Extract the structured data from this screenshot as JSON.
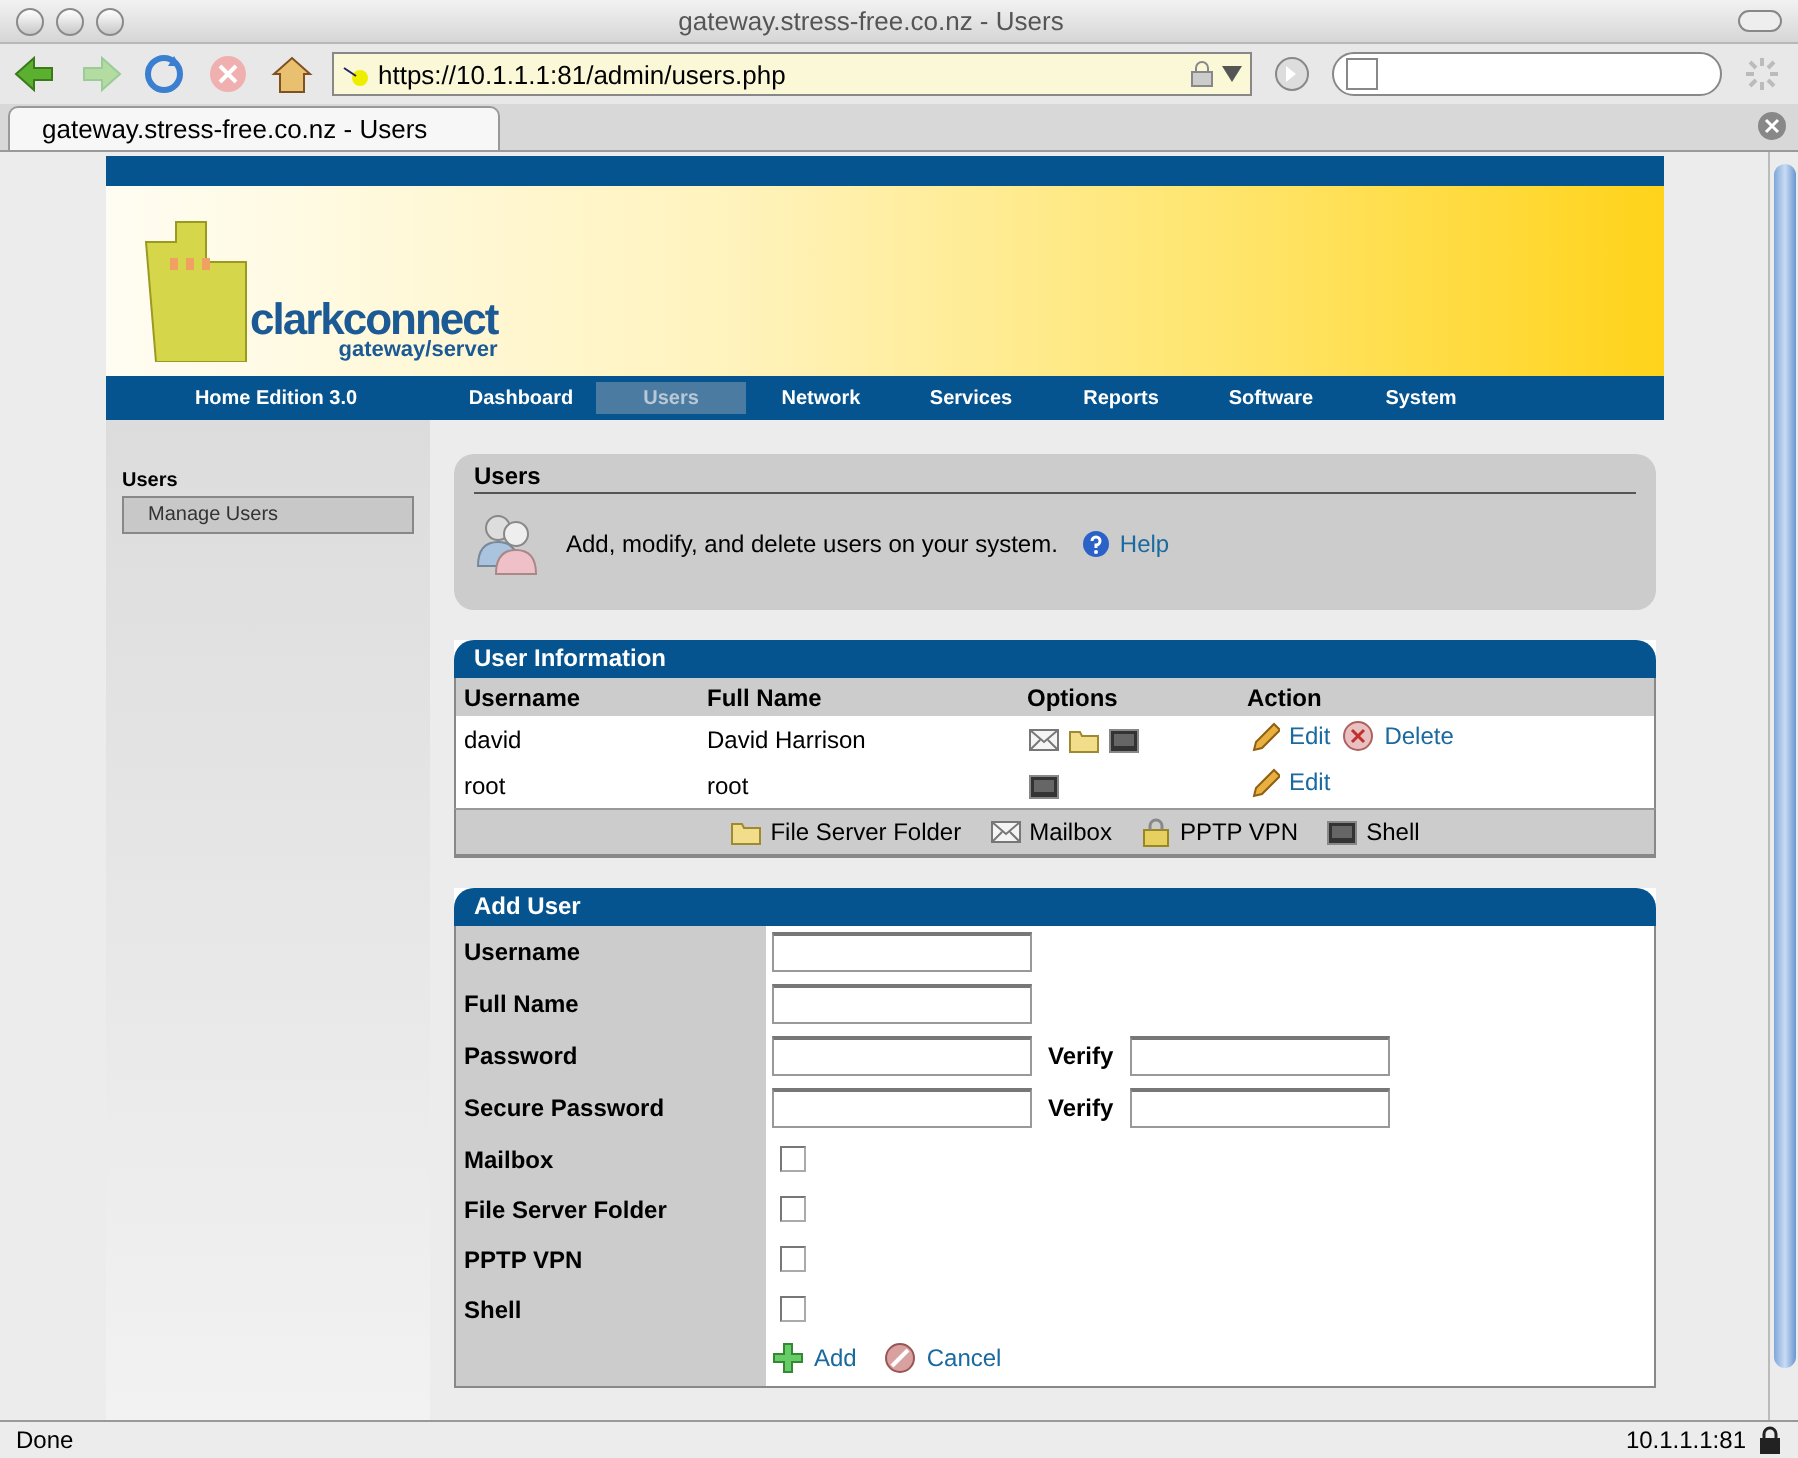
{
  "window": {
    "title": "gateway.stress-free.co.nz - Users"
  },
  "toolbar": {
    "url": "https://10.1.1.1:81/admin/users.php"
  },
  "tabs": [
    {
      "label": "gateway.stress-free.co.nz - Users",
      "selected": true
    }
  ],
  "header": {
    "logo": "clarkconnect",
    "logo_sub": "gateway/server",
    "edition": "Home Edition 3.0"
  },
  "nav": [
    {
      "label": "Dashboard",
      "selected": false
    },
    {
      "label": "Users",
      "selected": true
    },
    {
      "label": "Network",
      "selected": false
    },
    {
      "label": "Services",
      "selected": false
    },
    {
      "label": "Reports",
      "selected": false
    },
    {
      "label": "Software",
      "selected": false
    },
    {
      "label": "System",
      "selected": false
    }
  ],
  "sidebar": {
    "heading": "Users",
    "items": [
      {
        "label": "Manage Users",
        "selected": true
      }
    ]
  },
  "intro": {
    "title": "Users",
    "text": "Add, modify, and delete users on your system.",
    "help": "Help"
  },
  "user_info": {
    "title": "User Information",
    "columns": [
      "Username",
      "Full Name",
      "Options",
      "Action"
    ],
    "rows": [
      {
        "username": "david",
        "full_name": "David Harrison",
        "options": [
          {
            "kind": "mailbox"
          },
          {
            "kind": "folder"
          },
          {
            "kind": "shell"
          }
        ],
        "actions": [
          {
            "kind": "edit",
            "label": "Edit"
          },
          {
            "kind": "delete",
            "label": "Delete"
          }
        ]
      },
      {
        "username": "root",
        "full_name": "root",
        "options": [
          {
            "kind": "shell"
          }
        ],
        "actions": [
          {
            "kind": "edit",
            "label": "Edit"
          }
        ]
      }
    ],
    "legend": [
      {
        "kind": "folder",
        "label": "File Server Folder"
      },
      {
        "kind": "mailbox",
        "label": "Mailbox"
      },
      {
        "kind": "vpn",
        "label": "PPTP VPN"
      },
      {
        "kind": "shell",
        "label": "Shell"
      }
    ]
  },
  "add_user": {
    "title": "Add User",
    "fields": [
      {
        "kind": "text",
        "label": "Username"
      },
      {
        "kind": "text",
        "label": "Full Name"
      },
      {
        "kind": "pair",
        "label": "Password",
        "verify": "Verify"
      },
      {
        "kind": "pair",
        "label": "Secure Password",
        "verify": "Verify"
      },
      {
        "kind": "checkbox",
        "label": "Mailbox",
        "checked": false
      },
      {
        "kind": "checkbox",
        "label": "File Server Folder",
        "checked": false
      },
      {
        "kind": "checkbox",
        "label": "PPTP VPN",
        "checked": false
      },
      {
        "kind": "checkbox",
        "label": "Shell",
        "checked": false
      }
    ],
    "buttons": [
      {
        "kind": "add",
        "label": "Add"
      },
      {
        "kind": "cancel",
        "label": "Cancel"
      }
    ]
  },
  "status_bar": {
    "text": "Done",
    "host": "10.1.1.1:81"
  }
}
